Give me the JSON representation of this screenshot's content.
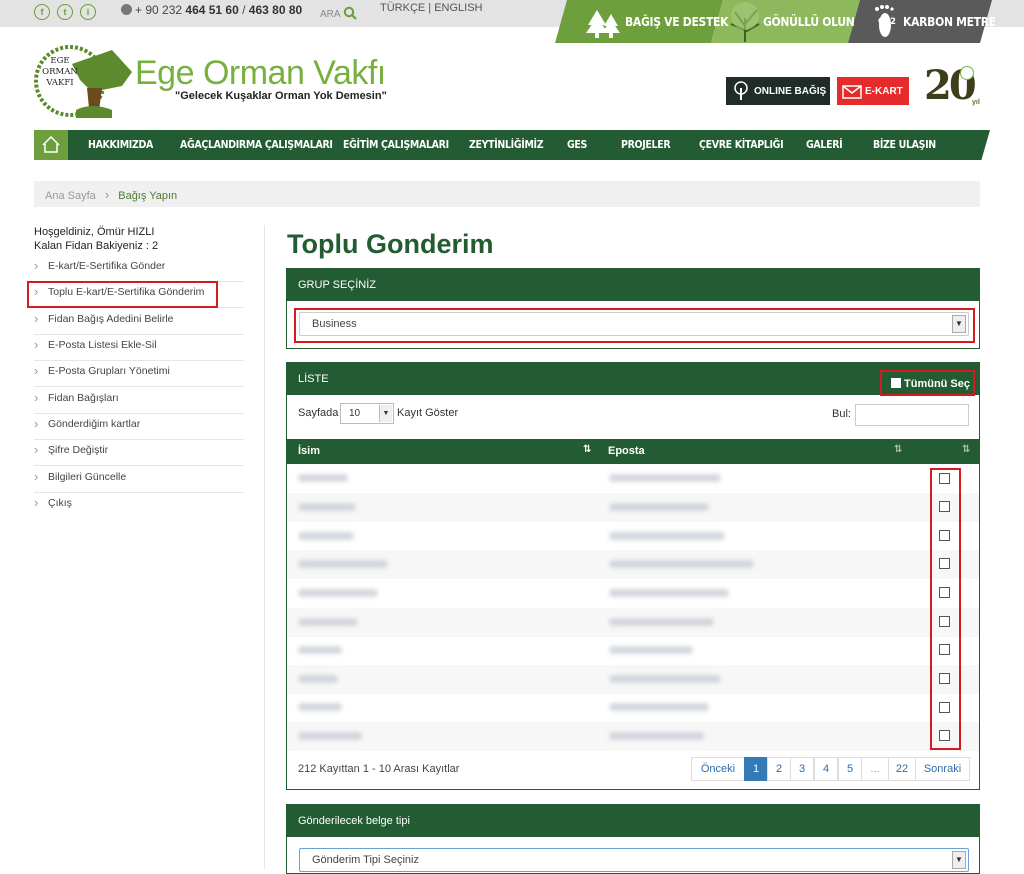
{
  "topbar": {
    "social": [
      "f",
      "t",
      "i"
    ],
    "phone_prefix": "+ 90 232 ",
    "phone_1": "464 51 60",
    "phone_sep": " / ",
    "phone_2": "463 80 80",
    "search_label": "ARA",
    "languages": "TÜRKÇE | ENGLISH"
  },
  "header_tabs": {
    "donate": "BAĞIŞ VE DESTEK",
    "volunteer": "GÖNÜLLÜ OLUN",
    "carbon": "KARBON METRE",
    "co2": "CO2"
  },
  "logo": {
    "seal_line1": "EGE",
    "seal_line2": "ORMAN",
    "seal_line3": "VAKFI",
    "title": "Ege Orman Vakfı",
    "slogan": "\"Gelecek Kuşaklar Orman Yok Demesin\"",
    "anniversary": "20",
    "anniversary_suffix": "yıl"
  },
  "buttons": {
    "online_donation": "ONLINE BAĞIŞ",
    "ekart": "E-KART"
  },
  "nav": [
    "HAKKIMIZDA",
    "AĞAÇLANDIRMA ÇALIŞMALARI",
    "EĞİTİM ÇALIŞMALARI",
    "ZEYTİNLİĞİMİZ",
    "GES",
    "PROJELER",
    "ÇEVRE KİTAPLIĞI",
    "GALERİ",
    "BİZE ULAŞIN"
  ],
  "breadcrumb": {
    "home": "Ana Sayfa",
    "current": "Bağış Yapın"
  },
  "sidebar": {
    "welcome": "Hoşgeldiniz, Ömür HIZLI",
    "balance": "Kalan Fidan Bakiyeniz : 2",
    "items": [
      "E-kart/E-Sertifika Gönder",
      "Toplu E-kart/E-Sertifika Gönderim",
      "Fidan Bağış Adedini Belirle",
      "E-Posta Listesi Ekle-Sil",
      "E-Posta Grupları Yönetimi",
      "Fidan Bağışları",
      "Gönderdiğim kartlar",
      "Şifre Değiştir",
      "Bilgileri Güncelle",
      "Çıkış"
    ]
  },
  "main": {
    "title": "Toplu Gonderim",
    "group_panel_title": "GRUP SEÇİNİZ",
    "group_selected": "Business",
    "list_panel_title": "LİSTE",
    "select_all": "Tümünü Seç",
    "per_page_label": "Sayfada",
    "per_page_value": "10",
    "per_page_suffix": "Kayıt Göster",
    "search_label": "Bul:",
    "col_name": "İsim",
    "col_email": "Eposta",
    "summary": "212 Kayıttan 1 - 10 Arası Kayıtlar",
    "pagination": {
      "prev": "Önceki",
      "pages": [
        "1",
        "2",
        "3",
        "4",
        "5",
        "...",
        "22"
      ],
      "next": "Sonraki"
    },
    "doc_panel_title": "Gönderilecek belge tipi",
    "doc_selected": "Gönderim Tipi Seçiniz"
  },
  "colors": {
    "dark_green": "#235c32",
    "light_green": "#78b03f",
    "red": "#d71920"
  }
}
